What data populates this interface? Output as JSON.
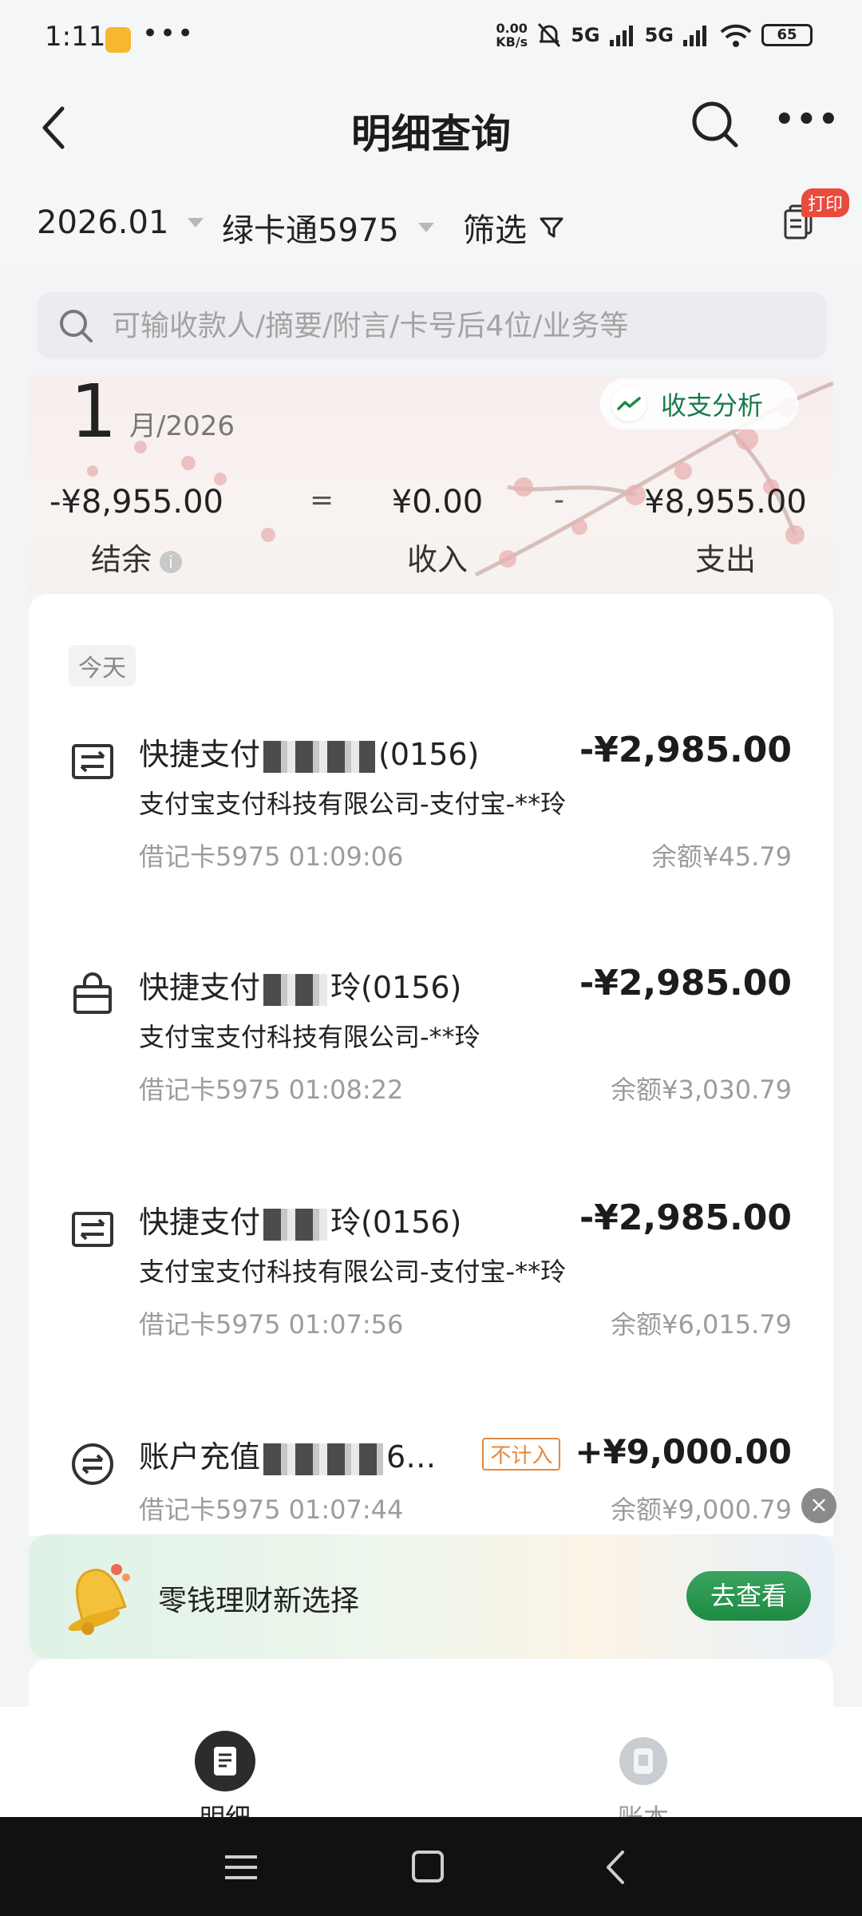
{
  "status_bar": {
    "time": "1:11",
    "dots": "•••",
    "net_speed_top": "0.00",
    "net_speed_bottom": "KB/s",
    "sig1": "5G",
    "sig2": "5G",
    "battery": "65"
  },
  "header": {
    "title": "明细查询",
    "back_icon": "chevron-left-icon",
    "search_icon": "search-icon",
    "more_label": "•••"
  },
  "filters": {
    "month": "2026.01",
    "card": "绿卡通5975",
    "filter_label": "筛选",
    "print_badge": "打印"
  },
  "search": {
    "placeholder": "可输收款人/摘要/附言/卡号后4位/业务等"
  },
  "summary": {
    "month_big": "1",
    "month_small": "月/2026",
    "analysis_label": "收支分析",
    "balance_value": "-¥8,955.00",
    "balance_label": "结余",
    "eq": "=",
    "minus": "-",
    "income_value": "¥0.00",
    "income_label": "收入",
    "expense_value": "¥8,955.00",
    "expense_label": "支出"
  },
  "list": {
    "day_label": "今天",
    "transactions": [
      {
        "title_prefix": "快捷支付",
        "title_suffix": "(0156)",
        "amount": "-¥2,985.00",
        "subtitle": "支付宝支付科技有限公司-支付宝-**玲",
        "meta": "借记卡5975 01:09:06",
        "balance": "余额¥45.79",
        "icon": "transfer-icon"
      },
      {
        "title_prefix": "快捷支付",
        "title_suffix": "玲(0156)",
        "amount": "-¥2,985.00",
        "subtitle": "支付宝支付科技有限公司-**玲",
        "meta": "借记卡5975 01:08:22",
        "balance": "余额¥3,030.79",
        "icon": "shopping-bag-icon"
      },
      {
        "title_prefix": "快捷支付",
        "title_suffix": "玲(0156)",
        "amount": "-¥2,985.00",
        "subtitle": "支付宝支付科技有限公司-支付宝-**玲",
        "meta": "借记卡5975 01:07:56",
        "balance": "余额¥6,015.79",
        "icon": "transfer-icon"
      },
      {
        "title_prefix": "账户充值",
        "title_suffix": "6…",
        "tag": "不计入",
        "amount": "+¥9,000.00",
        "meta": "借记卡5975 01:07:44",
        "balance": "余额¥9,000.79",
        "icon": "exchange-icon"
      }
    ]
  },
  "promo": {
    "text": "零钱理财新选择",
    "button": "去查看",
    "close": "×"
  },
  "bottom_nav": {
    "items": [
      {
        "label": "明细",
        "icon": "document-icon",
        "active": true
      },
      {
        "label": "账本",
        "icon": "ledger-icon",
        "active": false
      }
    ]
  },
  "colors": {
    "accent_green": "#1e8a44",
    "tag_orange": "#e6883c",
    "badge_red": "#e94b3c"
  }
}
